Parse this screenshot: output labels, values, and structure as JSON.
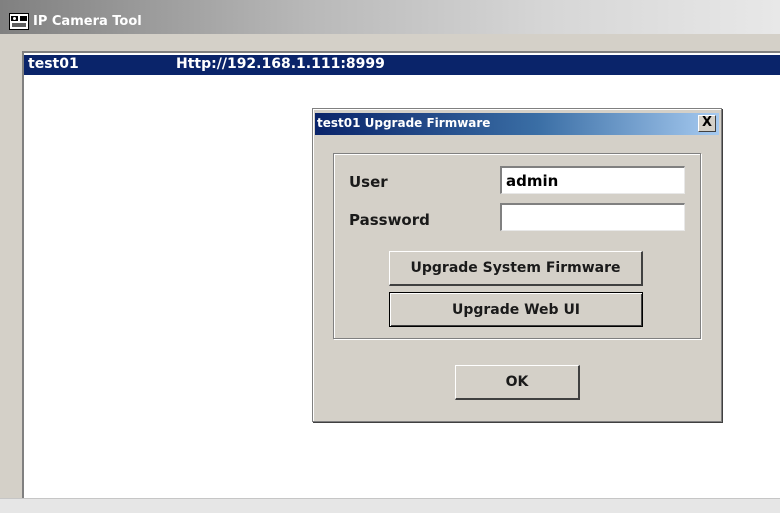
{
  "app": {
    "title": "IP Camera Tool",
    "icon": "camera-tool-icon"
  },
  "device_list": {
    "rows": [
      {
        "name": "test01",
        "url": "Http://192.168.1.111:8999",
        "selected": true
      }
    ]
  },
  "dialog": {
    "title": "test01 Upgrade Firmware",
    "close_label": "X",
    "user_label": "User",
    "user_value": "admin",
    "password_label": "Password",
    "password_value": "",
    "upgrade_system_label": "Upgrade System Firmware",
    "upgrade_webui_label": "Upgrade Web UI",
    "ok_label": "OK"
  },
  "colors": {
    "selection": "#0a246a",
    "dialog_bg": "#d4d0c8"
  }
}
